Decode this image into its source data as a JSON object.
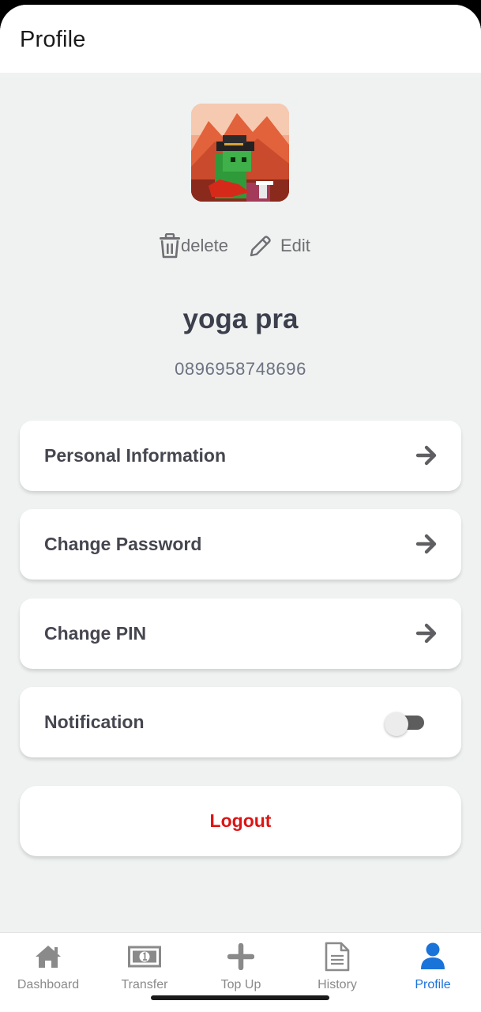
{
  "header": {
    "title": "Profile"
  },
  "profile": {
    "delete_label": "delete",
    "edit_label": "Edit",
    "name": "yoga pra",
    "phone": "0896958748696"
  },
  "menu": {
    "personal_info": "Personal Information",
    "change_password": "Change Password",
    "change_pin": "Change PIN",
    "notification": "Notification",
    "notification_enabled": false
  },
  "logout_label": "Logout",
  "nav": {
    "items": [
      {
        "label": "Dashboard",
        "icon": "home-icon"
      },
      {
        "label": "Transfer",
        "icon": "money-icon"
      },
      {
        "label": "Top Up",
        "icon": "plus-icon"
      },
      {
        "label": "History",
        "icon": "document-icon"
      },
      {
        "label": "Profile",
        "icon": "user-icon"
      }
    ],
    "active_index": 4
  },
  "colors": {
    "background": "#eff2f1",
    "text_primary": "#45464f",
    "logout": "#dd1414",
    "active_nav": "#1a73d9",
    "inactive_nav": "#8a8a8a"
  }
}
